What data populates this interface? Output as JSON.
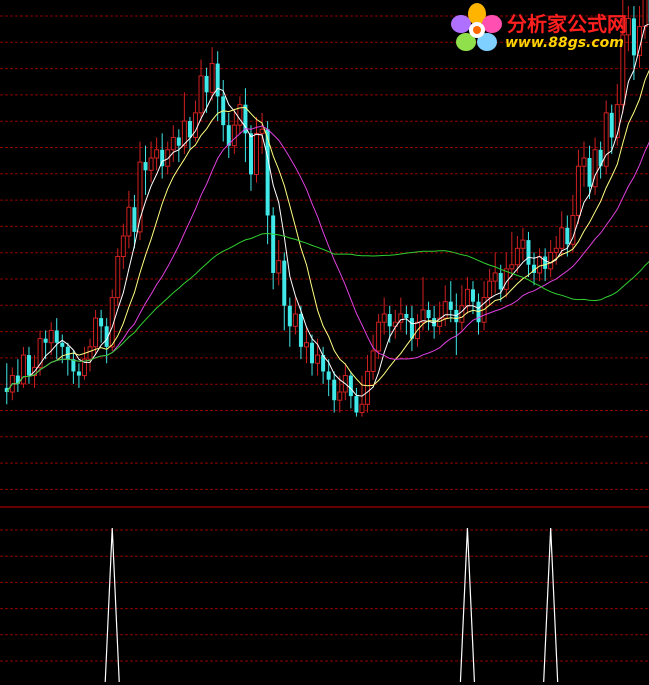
{
  "watermark": {
    "title": "分析家公式网",
    "url": "www.88gs.com",
    "title_color": "#ff1f1f",
    "url_color": "#ffd200"
  },
  "colors": {
    "background": "#000000",
    "grid": "#8b0000",
    "divider": "#cc0000",
    "up": "#d02020",
    "down": "#40e8e8",
    "ma5": "#ffffff",
    "ma10": "#ffff80",
    "ma20": "#e040e0",
    "ma60": "#30d030",
    "signal": "#ffffff"
  },
  "chart_data": [
    {
      "type": "candlestick",
      "title": "",
      "xlabel": "",
      "ylabel": "",
      "grid": true,
      "legend": "none",
      "ylim": [
        5.6,
        17.0
      ],
      "ohlc": [
        [
          7.6,
          7.5,
          7.2,
          8.2
        ],
        [
          7.5,
          7.9,
          7.3,
          8.1
        ],
        [
          7.9,
          7.7,
          7.5,
          8.3
        ],
        [
          7.7,
          8.4,
          7.6,
          8.6
        ],
        [
          8.4,
          7.9,
          7.7,
          8.6
        ],
        [
          7.9,
          8.1,
          7.6,
          8.4
        ],
        [
          8.1,
          8.8,
          7.9,
          9.0
        ],
        [
          8.8,
          8.7,
          8.3,
          9.0
        ],
        [
          8.7,
          9.0,
          8.4,
          9.2
        ],
        [
          9.0,
          8.7,
          8.3,
          9.3
        ],
        [
          8.7,
          8.6,
          8.2,
          8.9
        ],
        [
          8.6,
          8.3,
          7.9,
          8.7
        ],
        [
          8.3,
          8.0,
          7.7,
          8.5
        ],
        [
          8.0,
          7.9,
          7.6,
          8.2
        ],
        [
          7.9,
          8.3,
          7.8,
          8.6
        ],
        [
          8.3,
          8.6,
          8.0,
          8.8
        ],
        [
          8.6,
          9.3,
          8.4,
          9.5
        ],
        [
          9.3,
          9.1,
          8.7,
          9.5
        ],
        [
          9.1,
          8.6,
          8.2,
          9.3
        ],
        [
          8.6,
          9.8,
          8.5,
          10.0
        ],
        [
          9.8,
          10.8,
          9.6,
          11.0
        ],
        [
          10.8,
          11.3,
          10.5,
          11.6
        ],
        [
          11.3,
          12.0,
          11.0,
          12.4
        ],
        [
          12.0,
          11.4,
          11.0,
          12.3
        ],
        [
          11.4,
          13.1,
          11.2,
          13.6
        ],
        [
          13.1,
          12.9,
          12.3,
          13.5
        ],
        [
          12.9,
          13.2,
          12.6,
          13.6
        ],
        [
          13.2,
          13.4,
          12.9,
          13.7
        ],
        [
          13.4,
          13.0,
          12.7,
          13.8
        ],
        [
          13.0,
          13.4,
          12.8,
          13.6
        ],
        [
          13.4,
          13.7,
          13.1,
          14.0
        ],
        [
          13.7,
          13.5,
          13.1,
          13.9
        ],
        [
          13.5,
          14.1,
          13.3,
          14.8
        ],
        [
          14.1,
          13.7,
          13.4,
          14.2
        ],
        [
          13.7,
          14.3,
          13.6,
          14.6
        ],
        [
          14.3,
          15.2,
          14.1,
          15.6
        ],
        [
          15.2,
          14.8,
          14.3,
          15.4
        ],
        [
          14.8,
          15.5,
          14.6,
          15.9
        ],
        [
          15.5,
          14.7,
          14.1,
          15.8
        ],
        [
          14.7,
          14.0,
          13.6,
          15.1
        ],
        [
          14.0,
          13.5,
          13.2,
          14.3
        ],
        [
          13.5,
          14.0,
          13.3,
          14.4
        ],
        [
          14.0,
          14.5,
          13.8,
          14.7
        ],
        [
          14.5,
          13.8,
          13.1,
          14.9
        ],
        [
          13.8,
          12.8,
          12.4,
          14.0
        ],
        [
          12.8,
          13.8,
          12.6,
          14.2
        ],
        [
          13.8,
          13.9,
          13.3,
          14.3
        ],
        [
          13.9,
          11.8,
          11.1,
          14.1
        ],
        [
          11.8,
          10.4,
          10.0,
          12.0
        ],
        [
          10.4,
          10.7,
          10.1,
          11.2
        ],
        [
          10.7,
          9.6,
          9.0,
          10.9
        ],
        [
          9.6,
          9.1,
          8.6,
          9.8
        ],
        [
          9.1,
          9.4,
          8.9,
          9.8
        ],
        [
          9.4,
          8.6,
          8.3,
          9.6
        ],
        [
          8.6,
          8.7,
          8.2,
          9.1
        ],
        [
          8.7,
          8.2,
          7.9,
          8.9
        ],
        [
          8.2,
          8.4,
          7.9,
          8.8
        ],
        [
          8.4,
          8.0,
          7.7,
          8.6
        ],
        [
          8.0,
          7.8,
          7.4,
          8.3
        ],
        [
          7.8,
          7.3,
          7.0,
          8.0
        ],
        [
          7.3,
          7.5,
          7.0,
          7.9
        ],
        [
          7.5,
          7.9,
          7.3,
          8.2
        ],
        [
          7.9,
          7.4,
          7.1,
          8.0
        ],
        [
          7.4,
          7.0,
          6.9,
          7.6
        ],
        [
          7.0,
          7.2,
          6.9,
          7.9
        ],
        [
          7.2,
          8.0,
          7.0,
          8.4
        ],
        [
          8.0,
          8.5,
          7.8,
          8.9
        ],
        [
          8.5,
          9.2,
          8.3,
          9.4
        ],
        [
          9.2,
          9.4,
          8.9,
          9.8
        ],
        [
          9.4,
          9.1,
          8.7,
          9.6
        ],
        [
          9.1,
          9.2,
          8.8,
          9.5
        ],
        [
          9.2,
          9.4,
          9.0,
          9.8
        ],
        [
          9.4,
          9.3,
          8.9,
          9.6
        ],
        [
          9.3,
          8.8,
          8.5,
          9.6
        ],
        [
          8.8,
          9.2,
          8.6,
          9.4
        ],
        [
          9.2,
          9.5,
          9.0,
          10.3
        ],
        [
          9.5,
          9.3,
          9.0,
          9.7
        ],
        [
          9.3,
          9.1,
          8.8,
          9.6
        ],
        [
          9.1,
          9.3,
          8.9,
          9.7
        ],
        [
          9.3,
          9.7,
          9.1,
          10.1
        ],
        [
          9.7,
          9.5,
          9.2,
          10.2
        ],
        [
          9.5,
          9.2,
          8.4,
          9.9
        ],
        [
          9.2,
          9.6,
          9.0,
          10.1
        ],
        [
          9.6,
          10.0,
          9.4,
          10.3
        ],
        [
          10.0,
          9.7,
          9.4,
          10.2
        ],
        [
          9.7,
          9.2,
          8.9,
          9.9
        ],
        [
          9.2,
          9.8,
          9.0,
          10.2
        ],
        [
          9.8,
          10.2,
          9.6,
          10.5
        ],
        [
          10.2,
          10.4,
          9.9,
          10.9
        ],
        [
          10.4,
          10.0,
          9.7,
          10.6
        ],
        [
          10.0,
          10.5,
          9.8,
          10.9
        ],
        [
          10.5,
          10.6,
          10.3,
          11.4
        ],
        [
          10.6,
          11.0,
          10.4,
          11.3
        ],
        [
          11.0,
          11.2,
          10.7,
          11.5
        ],
        [
          11.2,
          10.6,
          10.3,
          11.4
        ],
        [
          10.6,
          10.4,
          10.1,
          10.9
        ],
        [
          10.4,
          10.8,
          10.2,
          11.0
        ],
        [
          10.8,
          10.5,
          10.2,
          11.0
        ],
        [
          10.5,
          10.9,
          10.3,
          11.2
        ],
        [
          10.9,
          11.0,
          10.6,
          11.3
        ],
        [
          11.0,
          11.5,
          10.8,
          11.9
        ],
        [
          11.5,
          11.1,
          10.8,
          11.8
        ],
        [
          11.1,
          11.8,
          10.9,
          12.3
        ],
        [
          11.8,
          13.0,
          11.6,
          13.4
        ],
        [
          13.0,
          13.2,
          12.5,
          13.6
        ],
        [
          13.2,
          12.5,
          12.2,
          13.5
        ],
        [
          12.5,
          13.4,
          12.3,
          13.7
        ],
        [
          13.4,
          13.0,
          12.7,
          13.6
        ],
        [
          13.0,
          14.3,
          12.8,
          14.6
        ],
        [
          14.3,
          13.7,
          13.3,
          14.5
        ],
        [
          13.7,
          14.5,
          13.5,
          15.0
        ],
        [
          14.5,
          16.2,
          14.3,
          17.8
        ],
        [
          16.2,
          16.6,
          15.8,
          16.9
        ],
        [
          16.6,
          15.7,
          15.1,
          16.9
        ],
        [
          15.7,
          16.4,
          15.4,
          16.9
        ],
        [
          16.4,
          17.2,
          16.1,
          17.6
        ],
        [
          17.2,
          16.5,
          16.2,
          17.3
        ],
        [
          16.5,
          16.3,
          16.0,
          17.1
        ]
      ],
      "moving_averages": [
        {
          "period": 5,
          "color_key": "ma5"
        },
        {
          "period": 10,
          "color_key": "ma10"
        },
        {
          "period": 20,
          "color_key": "ma20"
        },
        {
          "period": 60,
          "color_key": "ma60"
        }
      ]
    },
    {
      "type": "line",
      "title": "",
      "xlabel": "",
      "ylabel": "",
      "grid": true,
      "legend": "none",
      "ylim": [
        0,
        1
      ],
      "signal_indices": [
        19,
        83,
        98
      ],
      "signal_value": 1
    }
  ]
}
